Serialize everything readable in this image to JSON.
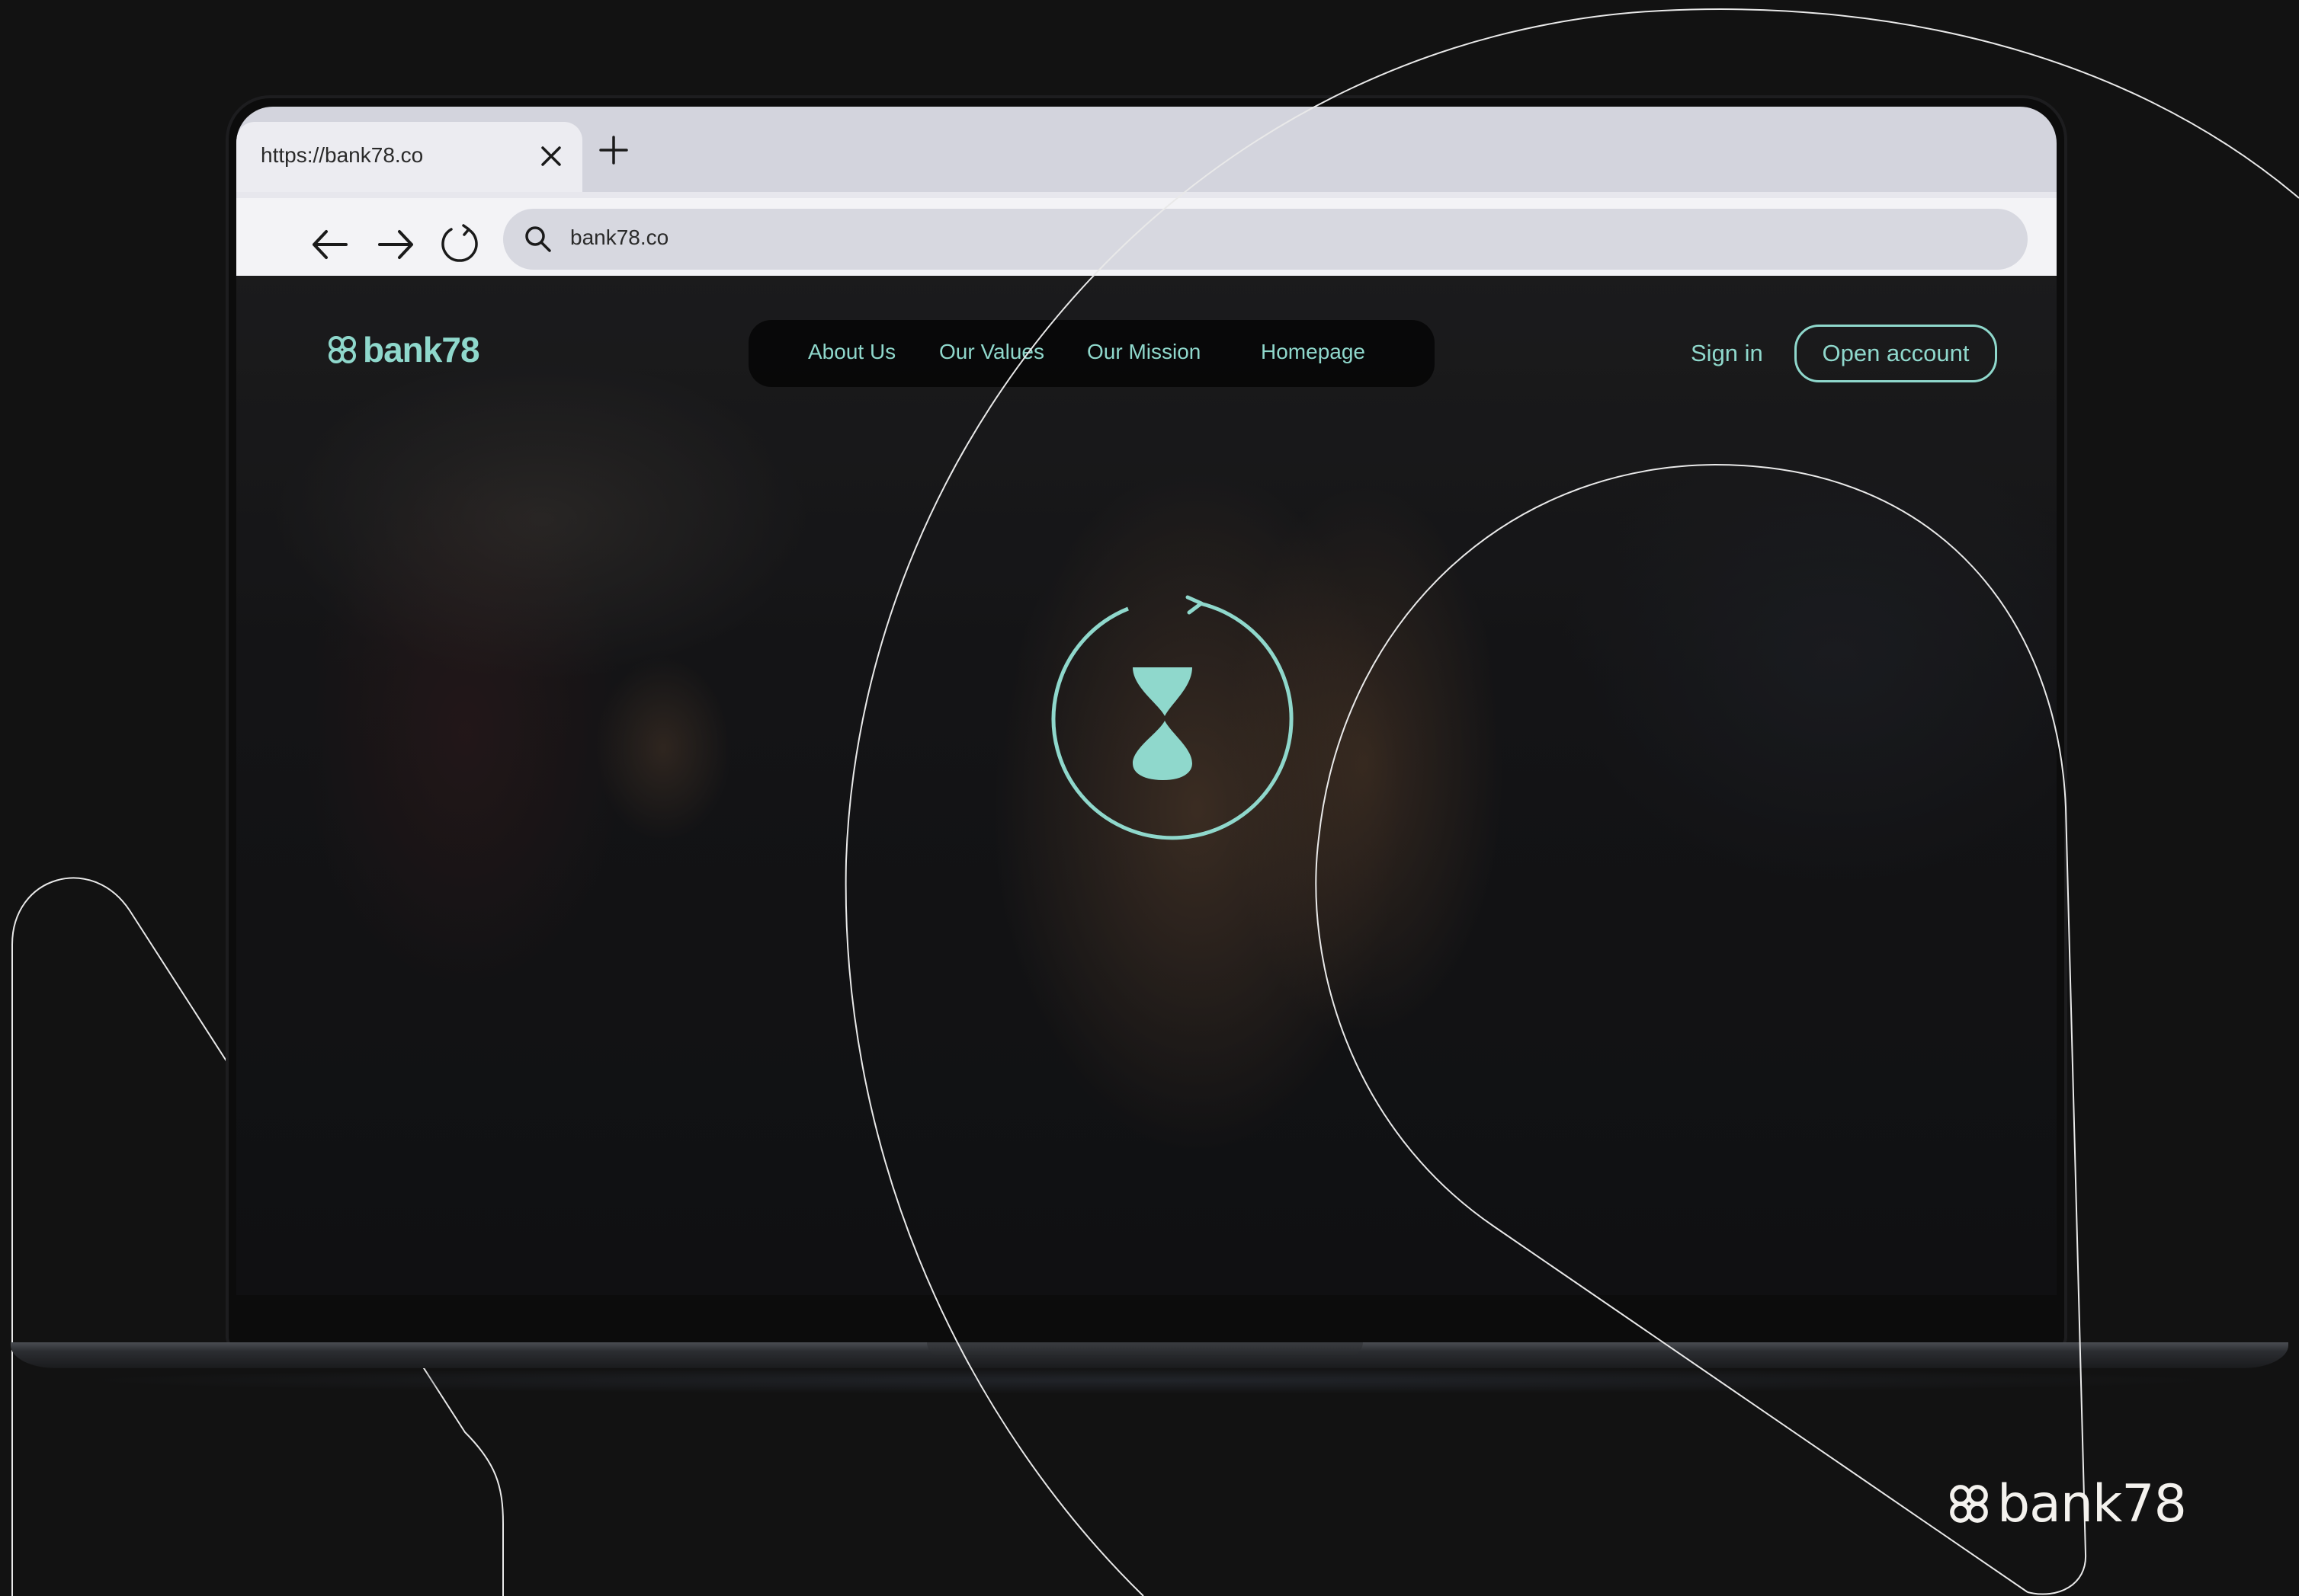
{
  "browser": {
    "tab": {
      "url": "https://bank78.co"
    },
    "address_bar": {
      "value": "bank78.co"
    }
  },
  "site": {
    "logo": "bank78",
    "nav": {
      "about": "About Us",
      "values": "Our Values",
      "mission": "Our Mission",
      "home": "Homepage"
    },
    "sign_in": "Sign in",
    "open_account": "Open account"
  },
  "brand": {
    "name": "bank78"
  },
  "colors": {
    "background": "#121212",
    "accent": "#8fd8cc",
    "browser_chrome": "#d3d4dd",
    "brand_text": "#f4f2ee"
  },
  "icons": [
    "close-icon",
    "plus-icon",
    "back-arrow-icon",
    "forward-arrow-icon",
    "reload-icon",
    "search-icon",
    "clover-logo-icon",
    "hourglass-icon"
  ]
}
